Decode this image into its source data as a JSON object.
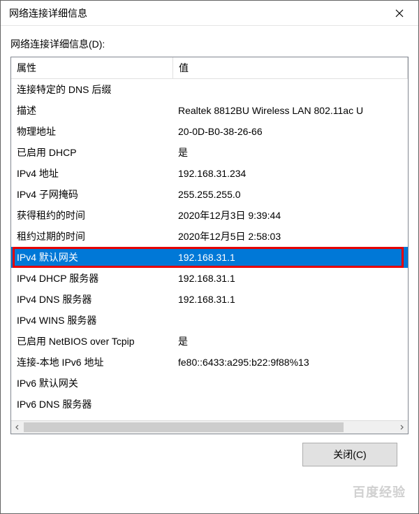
{
  "window": {
    "title": "网络连接详细信息"
  },
  "section_label": "网络连接详细信息(D):",
  "columns": {
    "property": "属性",
    "value": "值"
  },
  "rows": [
    {
      "prop": "连接特定的 DNS 后缀",
      "val": "",
      "selected": false
    },
    {
      "prop": "描述",
      "val": "Realtek 8812BU Wireless LAN 802.11ac U",
      "selected": false
    },
    {
      "prop": "物理地址",
      "val": "20-0D-B0-38-26-66",
      "selected": false
    },
    {
      "prop": "已启用 DHCP",
      "val": "是",
      "selected": false
    },
    {
      "prop": "IPv4 地址",
      "val": "192.168.31.234",
      "selected": false
    },
    {
      "prop": "IPv4 子网掩码",
      "val": "255.255.255.0",
      "selected": false
    },
    {
      "prop": "获得租约的时间",
      "val": "2020年12月3日 9:39:44",
      "selected": false
    },
    {
      "prop": "租约过期的时间",
      "val": "2020年12月5日 2:58:03",
      "selected": false
    },
    {
      "prop": "IPv4 默认网关",
      "val": "192.168.31.1",
      "selected": true,
      "boxed": true
    },
    {
      "prop": "IPv4 DHCP 服务器",
      "val": "192.168.31.1",
      "selected": false
    },
    {
      "prop": "IPv4 DNS 服务器",
      "val": "192.168.31.1",
      "selected": false
    },
    {
      "prop": "IPv4 WINS 服务器",
      "val": "",
      "selected": false
    },
    {
      "prop": "已启用 NetBIOS over Tcpip",
      "val": "是",
      "selected": false
    },
    {
      "prop": "连接-本地 IPv6 地址",
      "val": "fe80::6433:a295:b22:9f88%13",
      "selected": false
    },
    {
      "prop": "IPv6 默认网关",
      "val": "",
      "selected": false
    },
    {
      "prop": "IPv6 DNS 服务器",
      "val": "",
      "selected": false
    }
  ],
  "buttons": {
    "close": "关闭(C)"
  },
  "watermark": "百度经验"
}
